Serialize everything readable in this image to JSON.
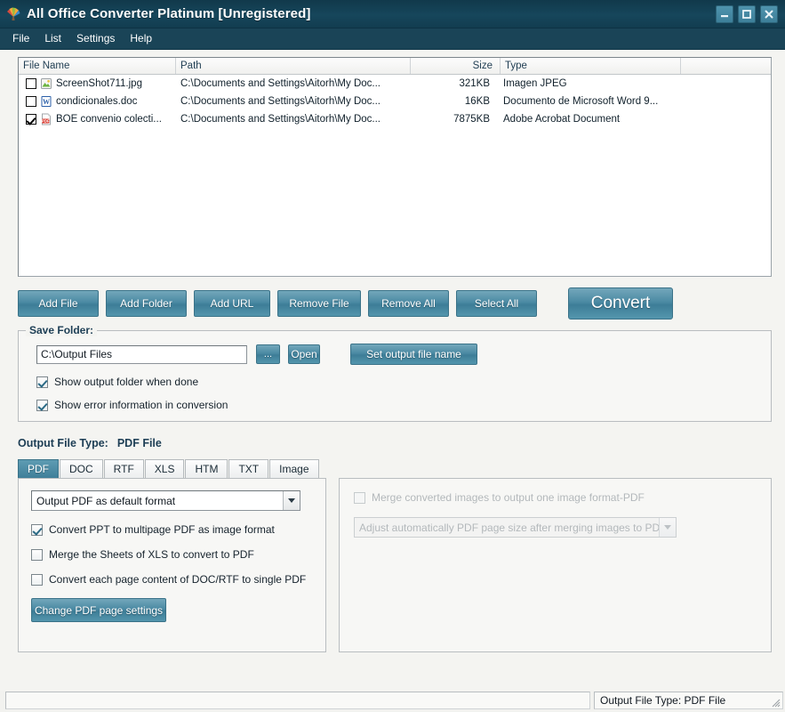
{
  "window": {
    "title": "All Office Converter Platinum [Unregistered]",
    "app_icon": "fan-burst-logo-icon",
    "controls": [
      {
        "name": "minimize-button",
        "glyph": "minimize-icon"
      },
      {
        "name": "maximize-button",
        "glyph": "maximize-icon"
      },
      {
        "name": "close-button",
        "glyph": "close-icon"
      }
    ]
  },
  "menubar": {
    "items": [
      {
        "label": "File"
      },
      {
        "label": "List"
      },
      {
        "label": "Settings"
      },
      {
        "label": "Help"
      }
    ]
  },
  "file_list": {
    "columns": [
      {
        "label": "File Name"
      },
      {
        "label": "Path"
      },
      {
        "label": "Size"
      },
      {
        "label": "Type"
      },
      {
        "label": ""
      }
    ],
    "rows": [
      {
        "checked": false,
        "icon": "image-file-icon",
        "name": "ScreenShot711.jpg",
        "path": "C:\\Documents and Settings\\Aitorh\\My Doc...",
        "size": "321KB",
        "type": "Imagen JPEG"
      },
      {
        "checked": false,
        "icon": "word-file-icon",
        "name": "condicionales.doc",
        "path": "C:\\Documents and Settings\\Aitorh\\My Doc...",
        "size": "16KB",
        "type": "Documento de Microsoft Word 9..."
      },
      {
        "checked": true,
        "icon": "pdf-file-icon",
        "name": "BOE convenio colecti...",
        "path": "C:\\Documents and Settings\\Aitorh\\My Doc...",
        "size": "7875KB",
        "type": "Adobe Acrobat Document"
      }
    ]
  },
  "actions": {
    "add_file": "Add File",
    "add_folder": "Add Folder",
    "add_url": "Add URL",
    "remove_file": "Remove File",
    "remove_all": "Remove All",
    "select_all": "Select All",
    "convert": "Convert"
  },
  "save_folder": {
    "title": "Save Folder:",
    "path_value": "C:\\Output Files",
    "path_placeholder": "C:\\Output Files",
    "browse_label": "...",
    "open_label": "Open",
    "set_output_name_label": "Set output file name",
    "show_output_folder": {
      "label": "Show output folder when done",
      "checked": true
    },
    "show_error_info": {
      "label": "Show error information in conversion",
      "checked": true
    }
  },
  "output_type": {
    "label": "Output File Type:",
    "value": "PDF File",
    "tabs": [
      {
        "label": "PDF",
        "active": true
      },
      {
        "label": "DOC",
        "active": false
      },
      {
        "label": "RTF",
        "active": false
      },
      {
        "label": "XLS",
        "active": false
      },
      {
        "label": "HTM",
        "active": false
      },
      {
        "label": "TXT",
        "active": false
      },
      {
        "label": "Image",
        "active": false
      }
    ]
  },
  "pdf_panel": {
    "format_combo": {
      "value": "Output PDF as default format"
    },
    "options": [
      {
        "label": "Convert PPT to multipage PDF as image format",
        "checked": true,
        "disabled": false
      },
      {
        "label": "Merge the Sheets of XLS to convert to PDF",
        "checked": false,
        "disabled": false
      },
      {
        "label": "Convert each page content of DOC/RTF to single PDF",
        "checked": false,
        "disabled": false
      }
    ],
    "page_settings_label": "Change PDF page settings"
  },
  "image_panel": {
    "merge_option": {
      "label": "Merge converted images to output one image format-PDF",
      "checked": false,
      "disabled": true
    },
    "adjust_combo": {
      "value": "Adjust automatically PDF page size after merging images to PDF",
      "disabled": true
    }
  },
  "statusbar": {
    "left": "",
    "right": "Output File Type:  PDF File"
  },
  "colors": {
    "titlebar": "#16465b",
    "menubar": "#1a4457",
    "accent_button": "#4b8aa3",
    "tab_active": "#3f7f99",
    "heading_text": "#1d3e55",
    "window_bg": "#f4f4f1"
  }
}
